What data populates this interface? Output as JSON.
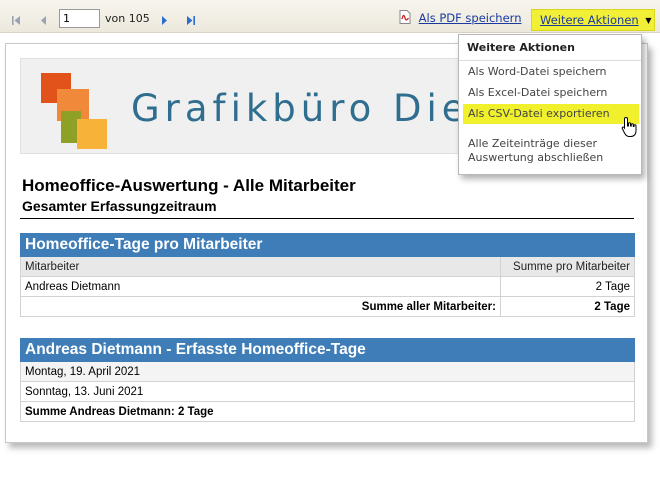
{
  "toolbar": {
    "page_current": "1",
    "page_of": "von 105",
    "pdf_label": "Als PDF speichern",
    "more_actions_label": "Weitere Aktionen"
  },
  "dropdown": {
    "title": "Weitere Aktionen",
    "items": [
      "Als Word-Datei speichern",
      "Als Excel-Datei speichern",
      "Als CSV-Datei exportieren",
      "Alle Zeiteinträge dieser Auswertung abschließen"
    ],
    "item4_line1": "Alle Zeiteinträge dieser",
    "item4_line2": "Auswertung abschließen"
  },
  "report": {
    "logo_text": "Grafikbüro Die",
    "title": "Homeoffice-Auswertung  - Alle Mitarbeiter",
    "subtitle": "Gesamter Erfassungzeitraum",
    "table1": {
      "heading": "Homeoffice-Tage pro Mitarbeiter",
      "col_employee": "Mitarbeiter",
      "col_sum": "Summe pro Mitarbeiter",
      "rows": [
        {
          "employee": "Andreas Dietmann",
          "sum": "2 Tage"
        }
      ],
      "total_label": "Summe aller Mitarbeiter:",
      "total_value": "2 Tage"
    },
    "table2": {
      "heading": "Andreas Dietmann - Erfasste Homeoffice-Tage",
      "rows": [
        "Montag, 19. April 2021",
        "Sonntag, 13. Juni 2021"
      ],
      "total": "Summe Andreas Dietmann: 2 Tage"
    }
  },
  "colors": {
    "accent_yellow": "#f2f036",
    "table_header_blue": "#3f7db8",
    "logo_text": "#2f6e8f",
    "logo_orange_dark": "#e2531c",
    "logo_orange": "#f08a3a",
    "logo_olive": "#8ea025",
    "logo_yellow": "#f7b23a"
  }
}
